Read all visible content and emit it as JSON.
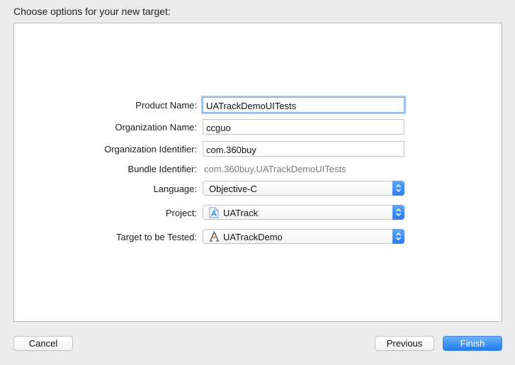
{
  "heading": "Choose options for your new target:",
  "form": {
    "product_name": {
      "label": "Product Name:",
      "value": "UATrackDemoUITests"
    },
    "organization_name": {
      "label": "Organization Name:",
      "value": "ccguo"
    },
    "organization_identifier": {
      "label": "Organization Identifier:",
      "value": "com.360buy"
    },
    "bundle_identifier": {
      "label": "Bundle Identifier:",
      "value": "com.360buy.UATrackDemoUITests"
    },
    "language": {
      "label": "Language:",
      "value": "Objective-C"
    },
    "project": {
      "label": "Project:",
      "value": "UATrack",
      "icon": "xcode-project-icon"
    },
    "target_to_be_tested": {
      "label": "Target to be Tested:",
      "value": "UATrackDemo",
      "icon": "app-target-icon"
    }
  },
  "buttons": {
    "cancel": "Cancel",
    "previous": "Previous",
    "finish": "Finish"
  },
  "colors": {
    "accent": "#2a7ef0",
    "focus_ring": "#a9c8f0",
    "secondary_text": "#7a7a7a"
  }
}
